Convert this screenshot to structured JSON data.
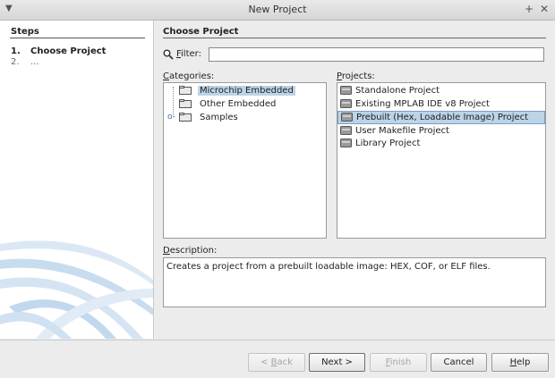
{
  "window": {
    "title": "New Project"
  },
  "steps": {
    "heading": "Steps",
    "items": [
      {
        "number": "1.",
        "label": "Choose Project"
      },
      {
        "number": "2.",
        "label": "..."
      }
    ]
  },
  "main": {
    "heading": "Choose Project",
    "filter": {
      "label_mnemonic": "F",
      "label_rest": "ilter:",
      "value": ""
    },
    "categories": {
      "label_mnemonic": "C",
      "label_rest": "ategories:",
      "items": [
        {
          "label": "Microchip Embedded",
          "selected": true,
          "expandable": false
        },
        {
          "label": "Other Embedded",
          "selected": false,
          "expandable": false
        },
        {
          "label": "Samples",
          "selected": false,
          "expandable": true
        }
      ]
    },
    "projects": {
      "label_mnemonic": "P",
      "label_rest": "rojects:",
      "items": [
        {
          "label": "Standalone Project",
          "selected": false
        },
        {
          "label": "Existing MPLAB IDE v8 Project",
          "selected": false
        },
        {
          "label": "Prebuilt (Hex, Loadable Image) Project",
          "selected": true
        },
        {
          "label": "User Makefile Project",
          "selected": false
        },
        {
          "label": "Library Project",
          "selected": false
        }
      ]
    },
    "description": {
      "label_mnemonic": "D",
      "label_rest": "escription:",
      "text": "Creates a project from a prebuilt loadable image: HEX, COF, or ELF files."
    }
  },
  "buttons": {
    "back": {
      "prefix": "< ",
      "mnemonic": "B",
      "rest": "ack",
      "enabled": false
    },
    "next": {
      "label": "Next >",
      "enabled": true
    },
    "finish": {
      "mnemonic": "F",
      "rest": "inish",
      "enabled": false
    },
    "cancel": {
      "label": "Cancel",
      "enabled": true
    },
    "help": {
      "mnemonic": "H",
      "rest": "elp",
      "enabled": true
    }
  },
  "colors": {
    "selection": "#bcd3e8",
    "selection_border": "#7a9ec3",
    "swoosh": "#c8dcef"
  },
  "icons": {
    "menu": "chevron-down-icon",
    "maximize": "plus-icon",
    "close": "close-icon",
    "filter": "search-icon",
    "category": "folder-icon",
    "project": "project-icon"
  }
}
